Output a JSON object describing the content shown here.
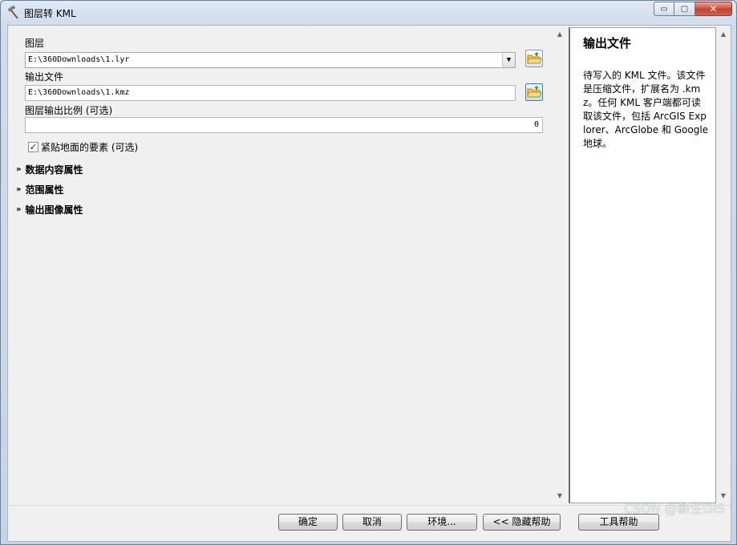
{
  "window": {
    "title": "图层转 KML",
    "min_glyph": "▭",
    "max_glyph": "▢",
    "close_glyph": "✕"
  },
  "form": {
    "layer_label": "图层",
    "layer_value": "E:\\360Downloads\\1.lyr",
    "output_label": "输出文件",
    "output_value": "E:\\360Downloads\\1.kmz",
    "scale_label": "图层输出比例 (可选)",
    "scale_value": "0",
    "clamp_label": "紧贴地面的要素 (可选)",
    "clamp_checked": true
  },
  "sections": [
    {
      "label": "数据内容属性",
      "icon": "chevron-double-down"
    },
    {
      "label": "范围属性",
      "icon": "chevron-double-down"
    },
    {
      "label": "输出图像属性",
      "icon": "chevron-double-down"
    }
  ],
  "help": {
    "title": "输出文件",
    "text": "待写入的 KML 文件。该文件是压缩文件，扩展名为 .kmz。任何 KML 客户端都可读取该文件，包括 ArcGIS Explorer、ArcGlobe 和 Google 地球。"
  },
  "buttons": {
    "ok": "确定",
    "cancel": "取消",
    "env": "环境...",
    "hide_help": "<< 隐藏帮助",
    "tool_help": "工具帮助"
  },
  "watermark": "CSDN @新生GIS",
  "colors": {
    "title_bar": "#dfe9f5",
    "close_button": "#c7432d",
    "panel_bg": "#f0f0f0"
  }
}
